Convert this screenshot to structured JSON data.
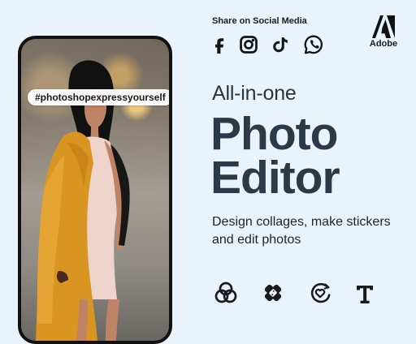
{
  "promo": {
    "hashtag": "#photoshopexpressyourself",
    "share_label": "Share on Social Media",
    "brand_name": "Adobe",
    "headline_small": "All-in-one",
    "headline_large_line1": "Photo",
    "headline_large_line2": "Editor",
    "subcopy": "Design collages, make stickers and edit photos"
  },
  "social_icons": [
    "facebook-icon",
    "instagram-icon",
    "tiktok-icon",
    "whatsapp-icon"
  ],
  "feature_icons": [
    "color-circles-icon",
    "bandage-icon",
    "heart-sticker-icon",
    "text-icon"
  ],
  "colors": {
    "background": "#e9f3fb",
    "headline": "#2b3a49",
    "body_text": "#1f2328",
    "jacket": "#d99522",
    "dress": "#efd4cc"
  }
}
